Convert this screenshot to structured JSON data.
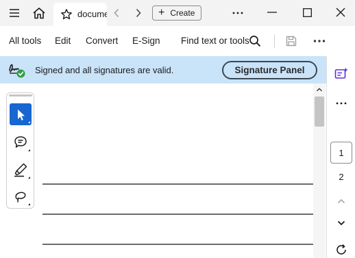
{
  "window": {
    "tab_title": "docume"
  },
  "titlebar": {
    "create_label": "Create"
  },
  "toolbar": {
    "items": [
      "All tools",
      "Edit",
      "Convert",
      "E-Sign"
    ],
    "find_label": "Find text or tools"
  },
  "signature": {
    "status_text": "Signed and all signatures are valid.",
    "panel_button": "Signature Panel",
    "status_color": "#2ea043"
  },
  "page_nav": {
    "current_page": "1",
    "next_page": "2"
  },
  "colors": {
    "accent": "#1866d1",
    "banner": "#c9e3f9",
    "rail_icon": "#5c2be2"
  }
}
